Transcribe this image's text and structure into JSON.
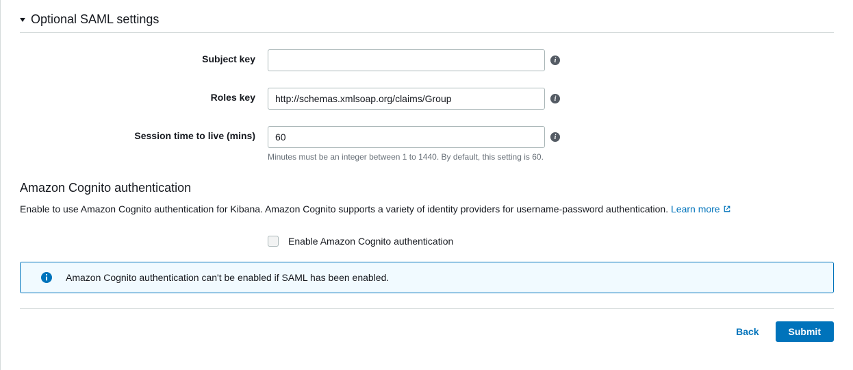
{
  "saml_section": {
    "title": "Optional SAML settings",
    "subject_key": {
      "label": "Subject key",
      "value": ""
    },
    "roles_key": {
      "label": "Roles key",
      "value": "http://schemas.xmlsoap.org/claims/Group"
    },
    "session_ttl": {
      "label": "Session time to live (mins)",
      "value": "60",
      "help": "Minutes must be an integer between 1 to 1440. By default, this setting is 60."
    }
  },
  "cognito_section": {
    "title": "Amazon Cognito authentication",
    "description": "Enable to use Amazon Cognito authentication for Kibana. Amazon Cognito supports a variety of identity providers for username-password authentication. ",
    "learn_more": "Learn more",
    "enable_label": "Enable Amazon Cognito authentication",
    "info_message": "Amazon Cognito authentication can't be enabled if SAML has been enabled."
  },
  "buttons": {
    "back": "Back",
    "submit": "Submit"
  }
}
